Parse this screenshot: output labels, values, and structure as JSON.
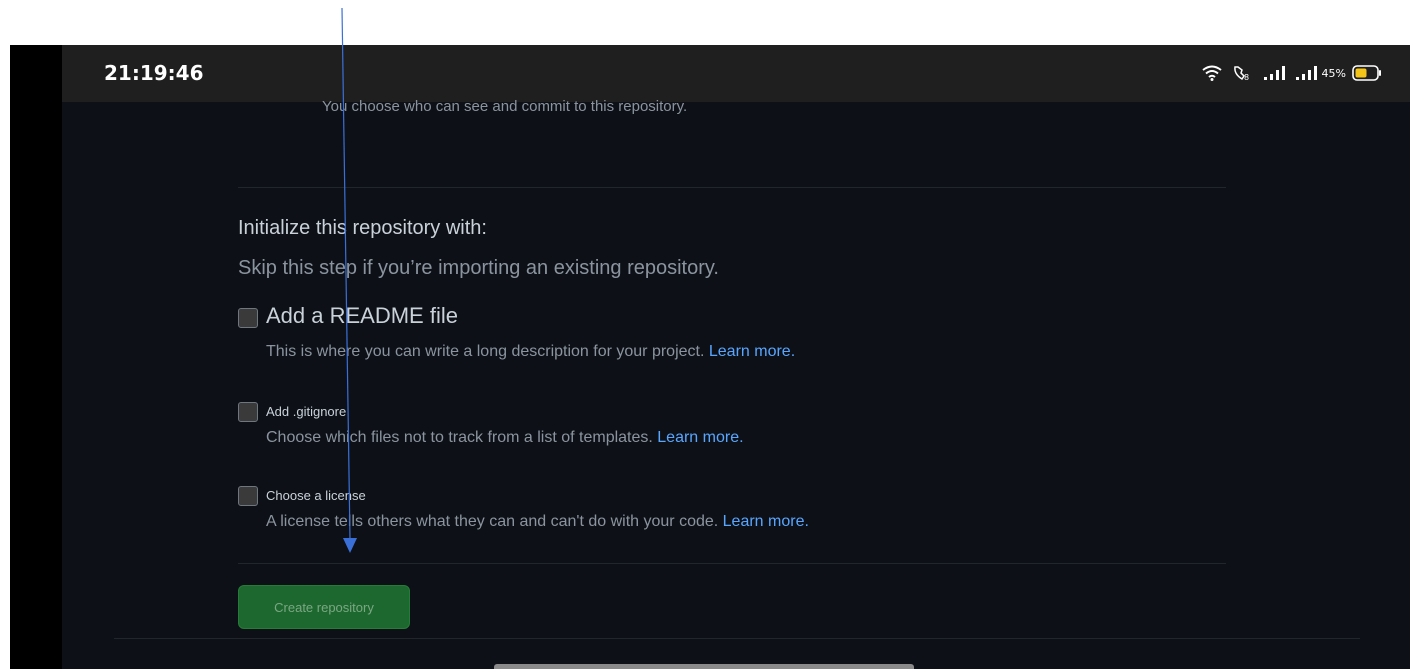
{
  "statusbar": {
    "time": "21:19:46",
    "battery_percent": "45%",
    "icons": [
      "wifi-icon",
      "wifi-calling-icon",
      "signal-icon",
      "signal-icon",
      "battery-icon"
    ]
  },
  "repo_form": {
    "visibility_note": "You choose who can see and commit to this repository.",
    "initialize_heading": "Initialize this repository with:",
    "initialize_hint": "Skip this step if you’re importing an existing repository.",
    "options": [
      {
        "title": "Add a README file",
        "description": "This is where you can write a long description for your project.",
        "link": "Learn more.",
        "checked": false
      },
      {
        "title": "Add .gitignore",
        "description": "Choose which files not to track from a list of templates.",
        "link": "Learn more.",
        "checked": false
      },
      {
        "title": "Choose a license",
        "description": "A license tells others what they can and can't do with your code.",
        "link": "Learn more.",
        "checked": false
      }
    ],
    "create_button": "Create repository"
  },
  "colors": {
    "background": "#0d1117",
    "text_primary": "#c9d1d9",
    "text_muted": "#8b949e",
    "link": "#58a6ff",
    "button_green": "#238636",
    "annotation_arrow": "#3b6fd8"
  }
}
